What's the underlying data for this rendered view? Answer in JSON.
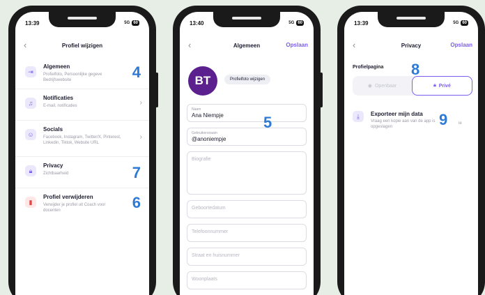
{
  "phone1": {
    "time": "13:39",
    "network": "5G",
    "battery": "60",
    "title": "Profiel wijzigen",
    "items": [
      {
        "title": "Algemeen",
        "sub": "Profielfoto, Persoonlijke gegeve Bedrijfswebsite",
        "badge": "4",
        "icon": "login-icon"
      },
      {
        "title": "Notificaties",
        "sub": "E-mail, notificaties",
        "icon": "bell-icon"
      },
      {
        "title": "Socials",
        "sub": "Facebook, Instagram, Twitter/X, Pinterest, Linkedin, Tiktok, Website URL",
        "icon": "people-icon"
      },
      {
        "title": "Privacy",
        "sub": "Zichtbaarheid",
        "badge": "7",
        "icon": "lock-icon"
      },
      {
        "title": "Profiel verwijderen",
        "sub": "Verwijder je profiel uit Coach voor docenten",
        "badge": "6",
        "icon": "trash-icon"
      }
    ]
  },
  "phone2": {
    "time": "13:40",
    "network": "5G",
    "battery": "60",
    "title": "Algemeen",
    "save": "Opslaan",
    "avatar_initials": "BT",
    "avatar_color": "#5b1f8e",
    "photo_button": "Profielfoto wijzigen",
    "badge": "5",
    "fields": {
      "name_label": "Naam",
      "name_value": "Ana Niempje",
      "username_label": "Gebruikersnaam",
      "username_value": "@anoniempje",
      "bio": "Biografie",
      "birthdate": "Geboortedatum",
      "phone": "Telefoonnummer",
      "street": "Straat en huisnummer",
      "city": "Woonplaats"
    }
  },
  "phone3": {
    "time": "13:39",
    "network": "5G",
    "battery": "60",
    "title": "Privacy",
    "save": "Opslaan",
    "section": "Profielpagina",
    "badge8": "8",
    "options": {
      "public": "Openbaar",
      "private": "Privé"
    },
    "export_title": "Exporteer mijn data",
    "export_sub": "Vraag een kopie aan van de app is opgeslagen",
    "export_sub_tail": "ie",
    "badge9": "9"
  },
  "colors": {
    "accent": "#7b5cf0",
    "badge": "#2e7bd6",
    "danger": "#e04848"
  }
}
